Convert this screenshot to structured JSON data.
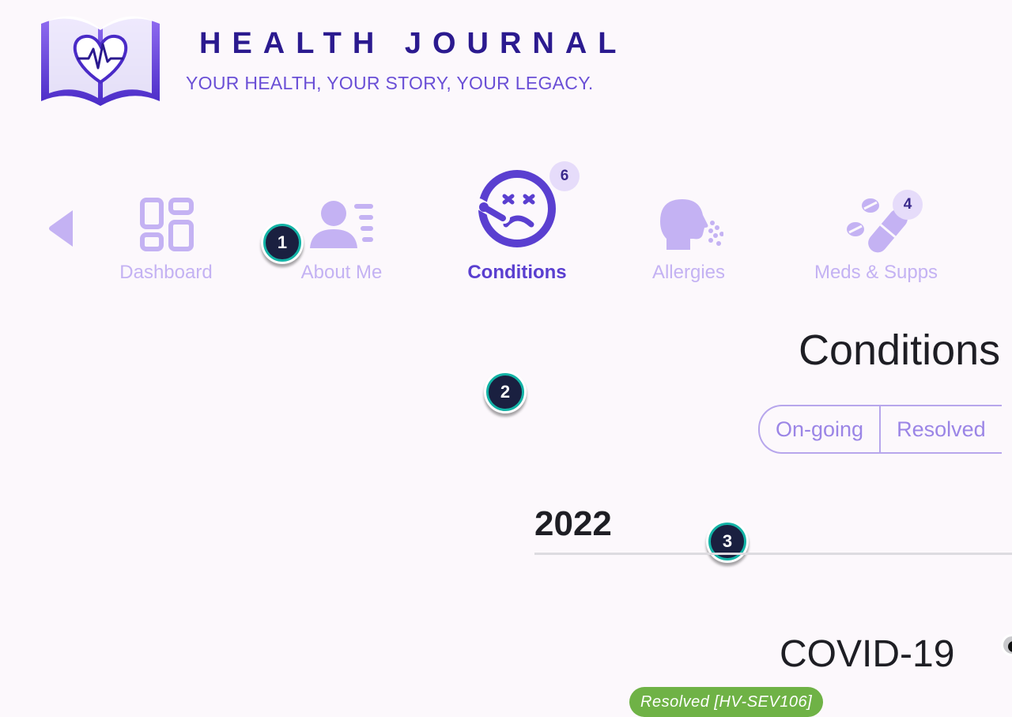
{
  "header": {
    "title": "HEALTH JOURNAL",
    "tagline": "YOUR HEALTH, YOUR STORY, YOUR LEGACY."
  },
  "nav": {
    "items": [
      {
        "label": "Dashboard",
        "icon": "dashboard-grid-icon",
        "active": false
      },
      {
        "label": "About Me",
        "icon": "person-list-icon",
        "active": false
      },
      {
        "label": "Conditions",
        "icon": "sick-face-thermometer-icon",
        "active": true,
        "badge": "6"
      },
      {
        "label": "Allergies",
        "icon": "sneezing-head-icon",
        "active": false
      },
      {
        "label": "Meds & Supps",
        "icon": "pills-capsule-icon",
        "active": false,
        "badge": "4"
      }
    ]
  },
  "markers": [
    "1",
    "2",
    "3"
  ],
  "content": {
    "heading": "Conditions",
    "filters": [
      "On-going",
      "Resolved"
    ],
    "year": "2022",
    "condition": {
      "name": "COVID-19",
      "status": "Resolved [HV-SEV106]"
    }
  },
  "colors": {
    "accent": "#5a3fd0",
    "nav_inactive": "#c4b2f3",
    "title": "#2b1a8f",
    "status_resolved": "#6fb246",
    "marker_ring": "#13b3a6"
  }
}
